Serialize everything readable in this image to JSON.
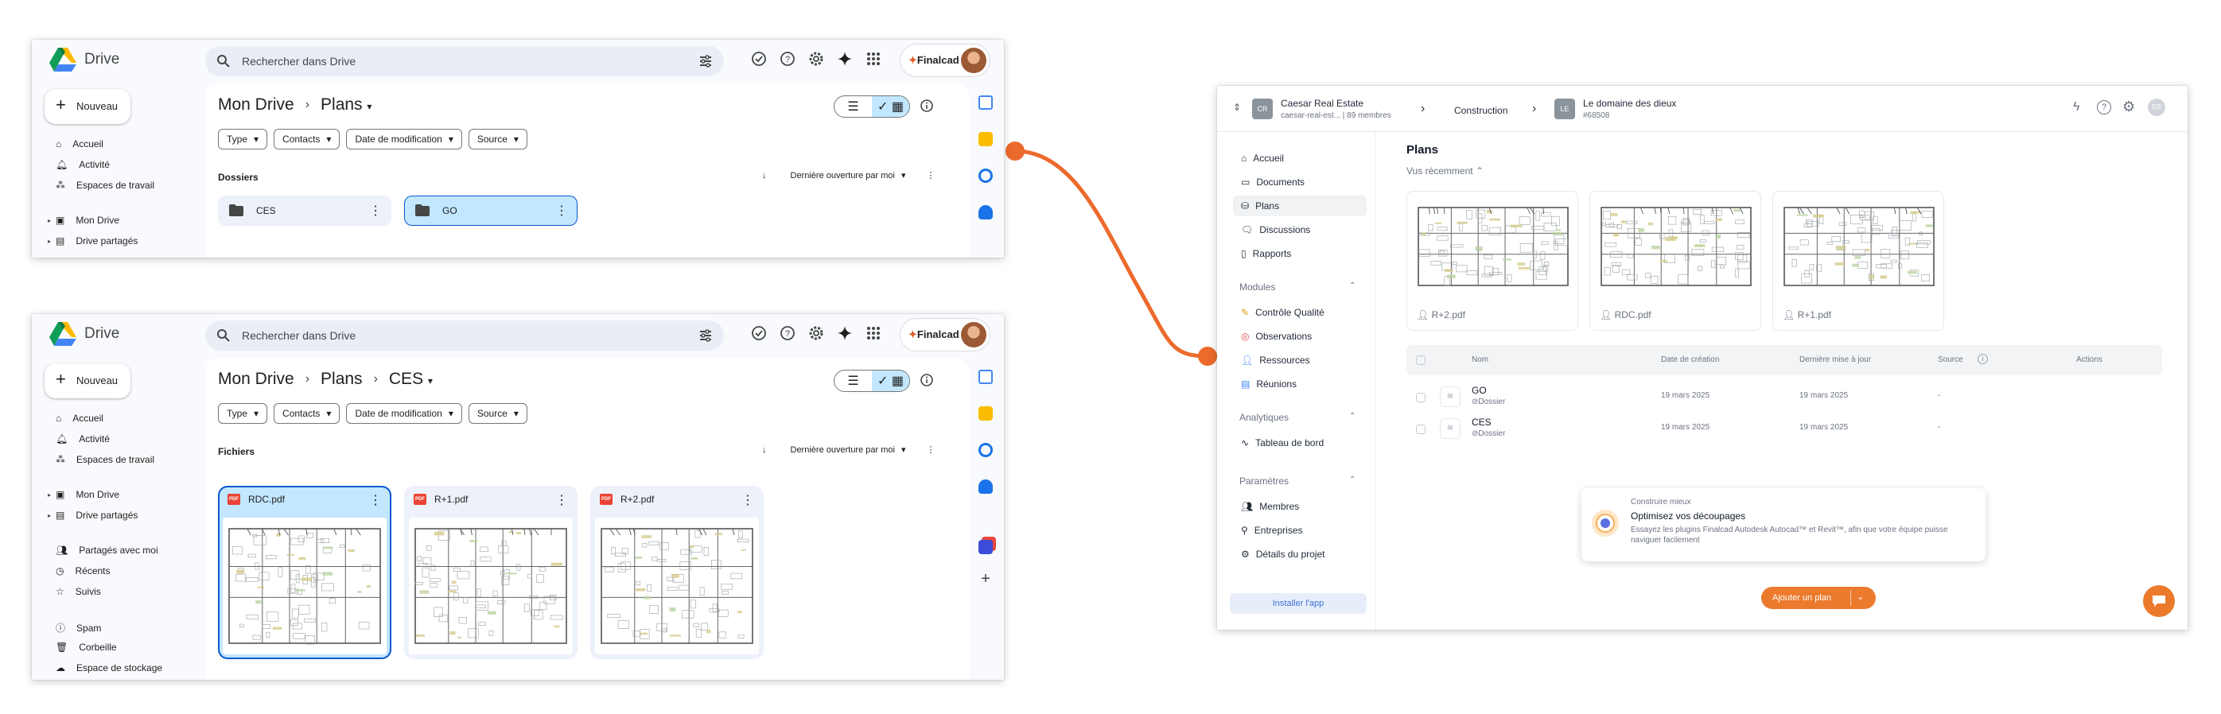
{
  "colors": {
    "connector": "#ec6a2c",
    "drive_blue": "#0b57d0",
    "accent_orange": "#ec7a2d"
  },
  "drive": {
    "app_title": "Drive",
    "search_placeholder": "Rechercher dans Drive",
    "brand": {
      "prefix": "✦",
      "name": "Finalcad"
    },
    "new_button": "Nouveau",
    "nav": {
      "home": "Accueil",
      "activity": "Activité",
      "workspaces": "Espaces de travail",
      "my_drive": "Mon Drive",
      "shared_drives": "Drive partagés",
      "shared_with_me": "Partagés avec moi",
      "recent": "Récents",
      "starred": "Suivis",
      "spam": "Spam",
      "trash": "Corbeille",
      "storage": "Espace de stockage"
    },
    "filters": [
      "Type",
      "Contacts",
      "Date de modification",
      "Source"
    ],
    "sort_label": "Dernière ouverture par moi",
    "window1": {
      "crumbs": [
        "Mon Drive",
        "Plans"
      ],
      "section": "Dossiers",
      "folders": [
        {
          "name": "CES"
        },
        {
          "name": "GO"
        }
      ]
    },
    "window2": {
      "crumbs": [
        "Mon Drive",
        "Plans",
        "CES"
      ],
      "section": "Fichiers",
      "files": [
        {
          "name": "RDC.pdf"
        },
        {
          "name": "R+1.pdf"
        },
        {
          "name": "R+2.pdf"
        }
      ]
    }
  },
  "finalcad": {
    "org": {
      "initials": "CR",
      "name": "Caesar Real Estate",
      "sub": "caesar-real-est... | 89 membres"
    },
    "breadcrumb_mid": "Construction",
    "project": {
      "initials": "LE",
      "name": "Le domaine des dieux",
      "code": "#68508"
    },
    "user_initials": "ES",
    "nav": [
      {
        "label": "Accueil",
        "icon": "home-icon"
      },
      {
        "label": "Documents",
        "icon": "folder-icon"
      },
      {
        "label": "Plans",
        "icon": "plans-icon"
      },
      {
        "label": "Discussions",
        "icon": "chat-icon"
      },
      {
        "label": "Rapports",
        "icon": "report-icon"
      }
    ],
    "modules_title": "Modules",
    "modules": [
      {
        "label": "Contrôle Qualité",
        "icon": "quality-icon"
      },
      {
        "label": "Observations",
        "icon": "observation-icon"
      },
      {
        "label": "Ressources",
        "icon": "resources-icon"
      },
      {
        "label": "Réunions",
        "icon": "meeting-icon"
      }
    ],
    "analytics_title": "Analytiques",
    "analytics": [
      {
        "label": "Tableau de bord",
        "icon": "dashboard-icon"
      }
    ],
    "settings_title": "Paramètres",
    "settings": [
      {
        "label": "Membres",
        "icon": "members-icon"
      },
      {
        "label": "Entreprises",
        "icon": "company-icon"
      },
      {
        "label": "Détails du projet",
        "icon": "details-icon"
      }
    ],
    "install_app": "Installer l'app",
    "page_title": "Plans",
    "recent_label": "Vus récemment",
    "recent_cards": [
      {
        "name": "R+2.pdf"
      },
      {
        "name": "RDC.pdf"
      },
      {
        "name": "R+1.pdf"
      }
    ],
    "table": {
      "headers": {
        "name": "Nom",
        "created": "Date de création",
        "updated": "Dernière mise à jour",
        "source": "Source",
        "actions": "Actions"
      },
      "rows": [
        {
          "name": "GO",
          "type": "Dossier",
          "created": "19 mars 2025",
          "updated": "19 mars 2025",
          "source": "-"
        },
        {
          "name": "CES",
          "type": "Dossier",
          "created": "19 mars 2025",
          "updated": "19 mars 2025",
          "source": "-"
        }
      ]
    },
    "toast": {
      "kicker": "Construire mieux",
      "title": "Optimisez vos découpages",
      "body": "Essayez les plugins Finalcad Autodesk Autocad™ et Revit™, afin que votre équipe puisse naviguer facilement"
    },
    "add_button": "Ajouter un plan"
  }
}
